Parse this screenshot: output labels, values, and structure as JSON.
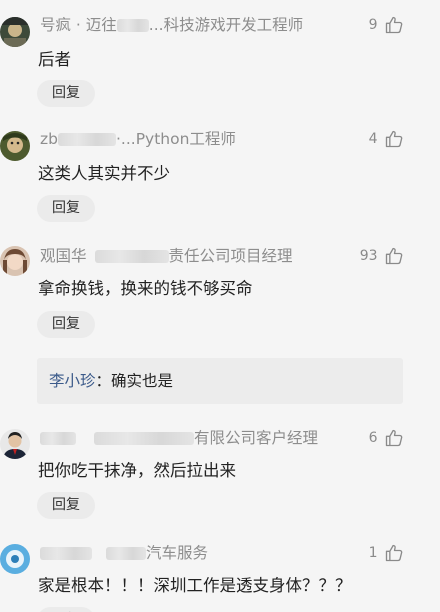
{
  "comments": [
    {
      "author_visible": "号疯 · 迈往",
      "author_tail": "...科技游戏开发工程师",
      "likes": "9",
      "text": "后者",
      "reply_label": "回复",
      "avatar_icon": "avatar-photo-dark"
    },
    {
      "author_visible": "zb",
      "author_tail": "·...Python工程师",
      "likes": "4",
      "text": "这类人其实并不少",
      "reply_label": "回复",
      "avatar_icon": "avatar-photo-green"
    },
    {
      "author_visible": "观国华",
      "author_tail": "责任公司项目经理",
      "likes": "93",
      "text": "拿命换钱，换来的钱不够买命",
      "reply_label": "回复",
      "avatar_icon": "avatar-photo-girl",
      "sub_reply": {
        "name": "李小珍",
        "separator": "：",
        "text": "确实也是"
      }
    },
    {
      "author_visible": "",
      "author_tail": "有限公司客户经理",
      "likes": "6",
      "text": "把你吃干抹净，然后拉出来",
      "reply_label": "回复",
      "avatar_icon": "avatar-photo-man"
    },
    {
      "author_visible": "",
      "author_tail": "汽车服务",
      "likes": "1",
      "text": "家是根本！！！深圳工作是透支身体？？？",
      "reply_label": "回复",
      "avatar_icon": "avatar-photo-blue"
    }
  ],
  "colors": {
    "background": "#f5f5f5",
    "meta_text": "#8d8d8d",
    "body_text": "#222222",
    "reply_button_bg": "#ebebeb",
    "sub_reply_bg": "#ececec",
    "sub_reply_name": "#3b5a8a"
  },
  "icons": {
    "like": "thumbs-up-icon"
  }
}
